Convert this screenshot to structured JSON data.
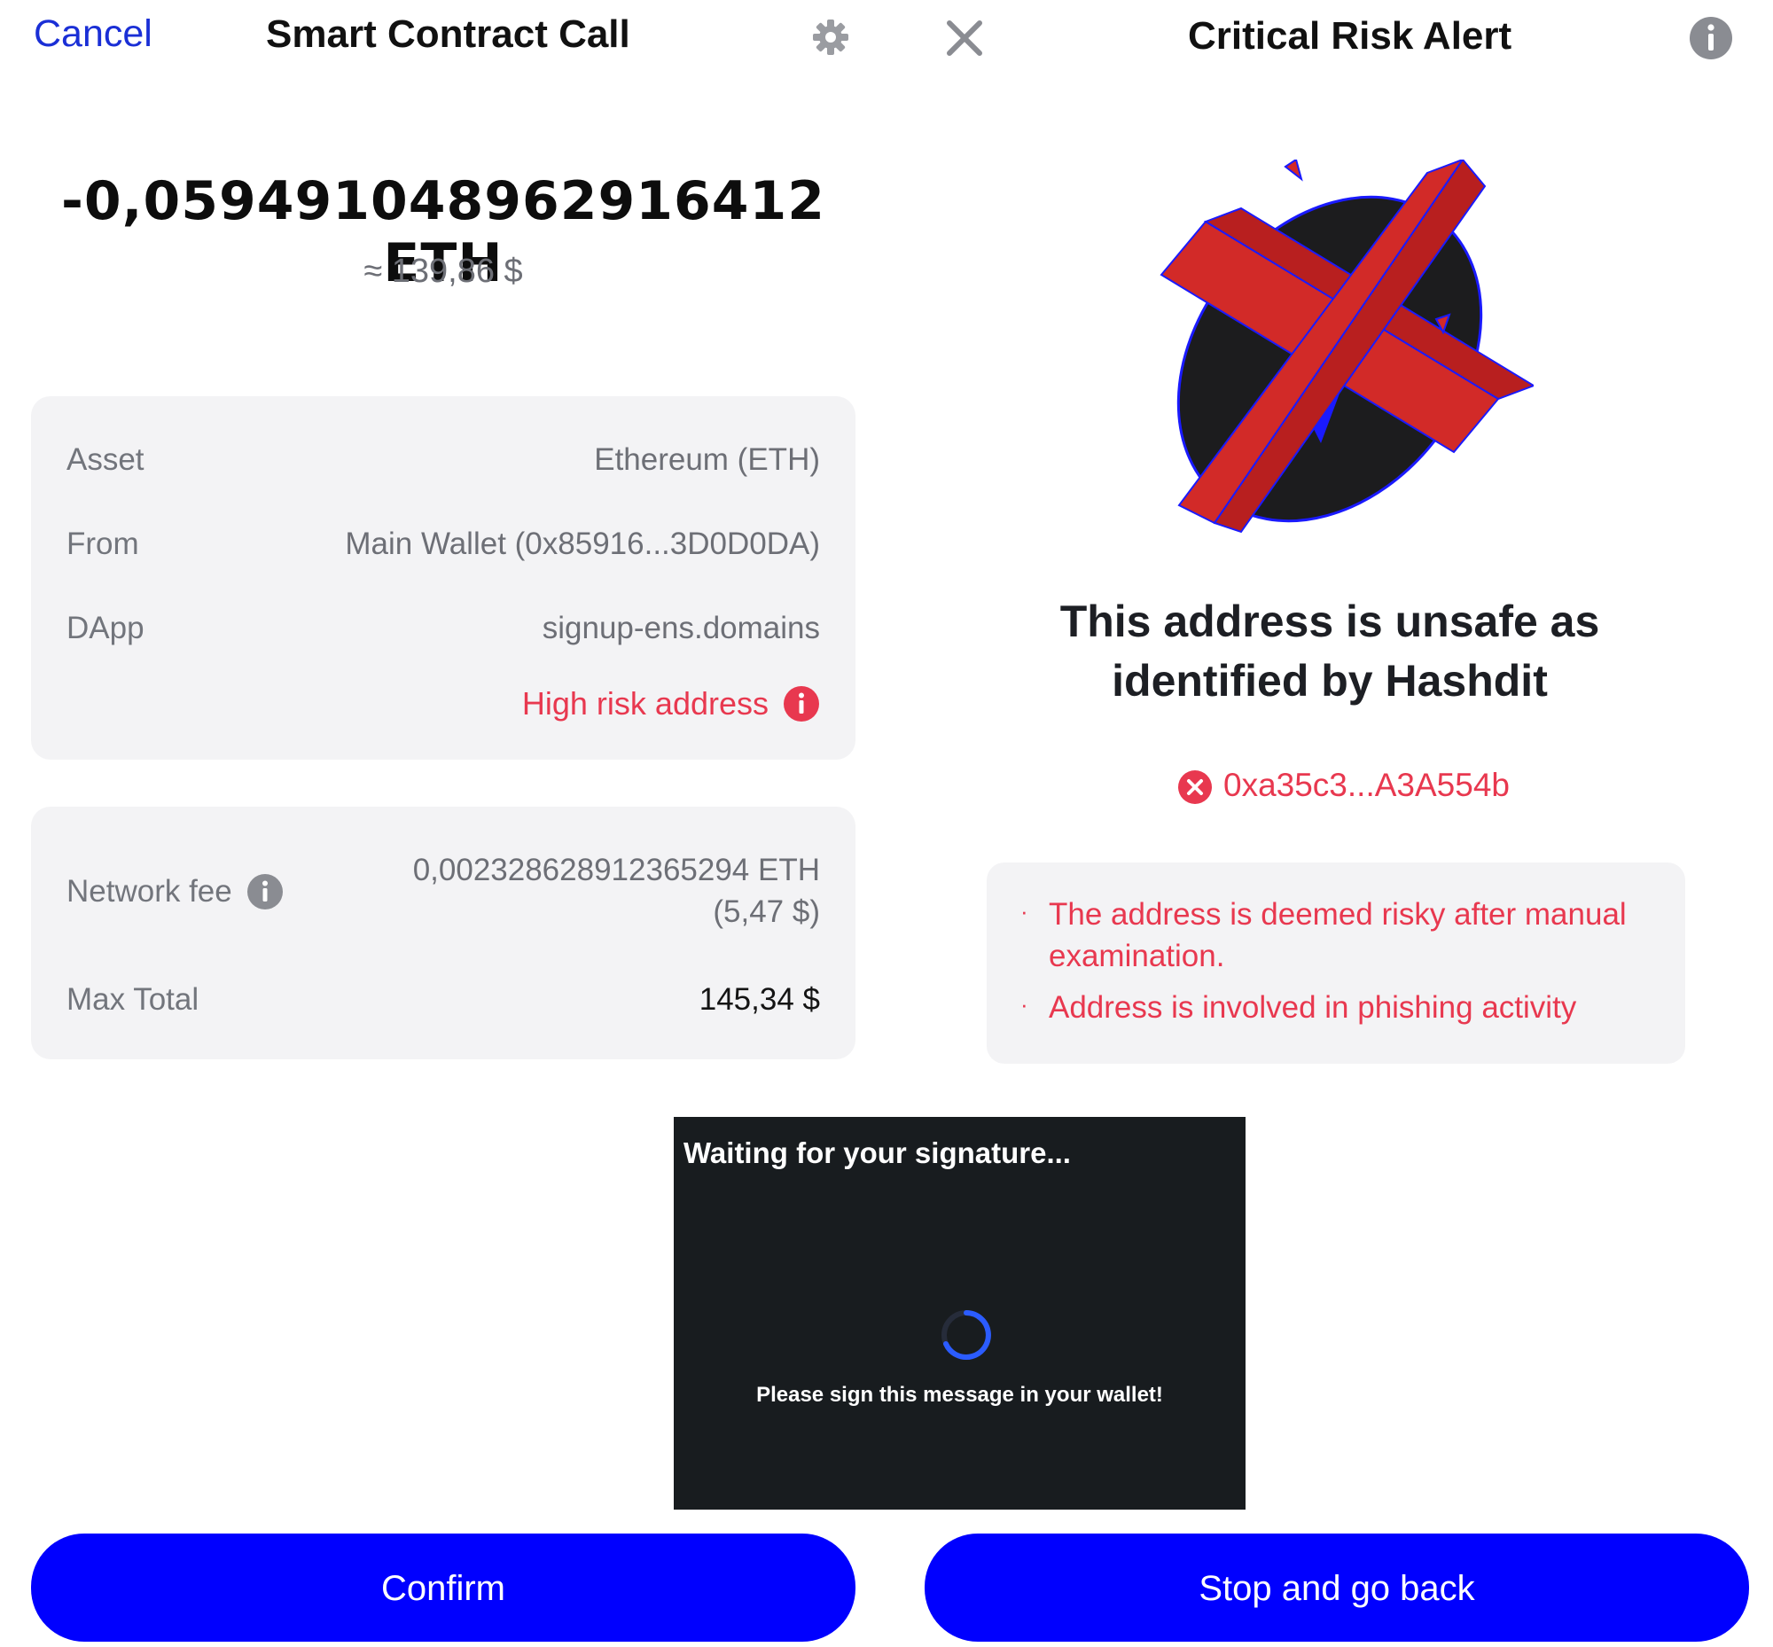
{
  "left_panel": {
    "cancel_label": "Cancel",
    "title": "Smart Contract Call",
    "amount": "-0,059491048962916412 ETH",
    "fiat": "≈ 139,86 $",
    "details": {
      "asset_label": "Asset",
      "asset_value": "Ethereum (ETH)",
      "from_label": "From",
      "from_value": "Main Wallet (0x85916...3D0D0DA)",
      "dapp_label": "DApp",
      "dapp_value": "signup-ens.domains",
      "risk_label": "High risk address"
    },
    "fees": {
      "network_fee_label": "Network fee",
      "network_fee_eth": "0,002328628912365294 ETH",
      "network_fee_fiat": "(5,47 $)",
      "max_total_label": "Max Total",
      "max_total_value": "145,34 $"
    },
    "confirm_label": "Confirm"
  },
  "right_panel": {
    "title": "Critical Risk Alert",
    "warning_line1": "This address is unsafe as",
    "warning_line2": "identified by Hashdit",
    "address": "0xa35c3...A3A554b",
    "reasons": [
      "The address is deemed risky after manual",
      "examination.",
      "Address is involved in phishing activity"
    ],
    "stop_label": "Stop and go back"
  },
  "overlay": {
    "title": "Waiting for your signature...",
    "message": "Please sign this message in your wallet!"
  },
  "icons": {
    "gear": "gear-icon",
    "close": "close-icon",
    "info": "info-icon",
    "error": "error-circle-icon",
    "spinner": "loading-spinner-icon"
  },
  "colors": {
    "primary_button": "#0000ff",
    "link_blue": "#1a2fd6",
    "danger": "#e8384f",
    "card_bg": "#f3f3f5",
    "overlay_bg": "#181c1f"
  }
}
